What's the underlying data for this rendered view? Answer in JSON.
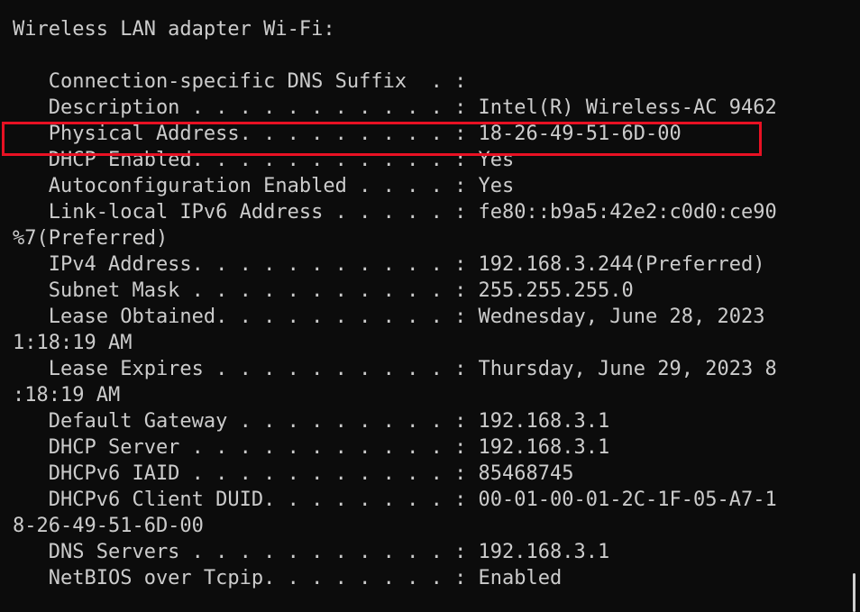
{
  "console": {
    "lines": [
      "Wireless LAN adapter Wi-Fi:",
      "",
      "   Connection-specific DNS Suffix  . :",
      "   Description . . . . . . . . . . . : Intel(R) Wireless-AC 9462",
      "   Physical Address. . . . . . . . . : 18-26-49-51-6D-00",
      "   DHCP Enabled. . . . . . . . . . . : Yes",
      "   Autoconfiguration Enabled . . . . : Yes",
      "   Link-local IPv6 Address . . . . . : fe80::b9a5:42e2:c0d0:ce90",
      "%7(Preferred)",
      "   IPv4 Address. . . . . . . . . . . : 192.168.3.244(Preferred)",
      "   Subnet Mask . . . . . . . . . . . : 255.255.255.0",
      "   Lease Obtained. . . . . . . . . . : Wednesday, June 28, 2023",
      "1:18:19 AM",
      "   Lease Expires . . . . . . . . . . : Thursday, June 29, 2023 8",
      ":18:19 AM",
      "   Default Gateway . . . . . . . . . : 192.168.3.1",
      "   DHCP Server . . . . . . . . . . . : 192.168.3.1",
      "   DHCPv6 IAID . . . . . . . . . . . : 85468745",
      "   DHCPv6 Client DUID. . . . . . . . : 00-01-00-01-2C-1F-05-A7-1",
      "8-26-49-51-6D-00",
      "   DNS Servers . . . . . . . . . . . : 192.168.3.1",
      "   NetBIOS over Tcpip. . . . . . . . : Enabled"
    ]
  },
  "highlight": {
    "target_line": "Physical Address",
    "color": "#e81123"
  },
  "colors": {
    "background": "#0c0c0c",
    "text": "#cccccc"
  }
}
